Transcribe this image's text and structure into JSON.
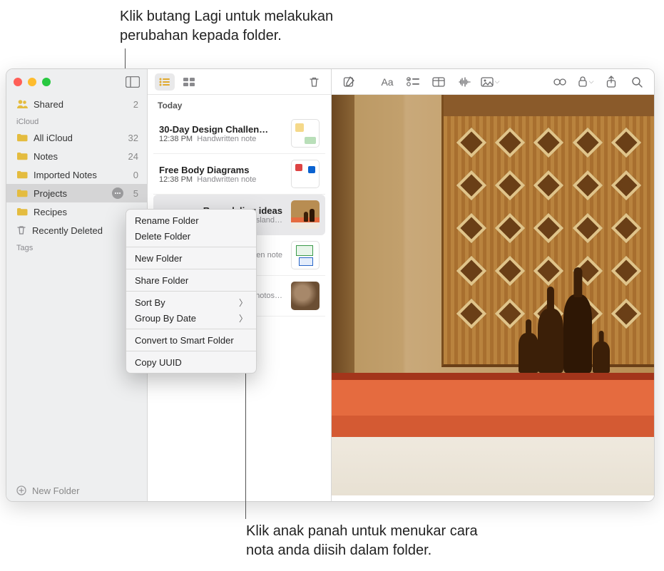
{
  "callouts": {
    "top": "Klik butang Lagi untuk melakukan\nperubahan kepada folder.",
    "bottom": "Klik anak panah untuk menukar cara\nnota anda diisih dalam folder."
  },
  "sidebar": {
    "shared": {
      "label": "Shared",
      "count": "2"
    },
    "sections": {
      "icloud_label": "iCloud",
      "tags_label": "Tags"
    },
    "folders": [
      {
        "label": "All iCloud",
        "count": "32"
      },
      {
        "label": "Notes",
        "count": "24"
      },
      {
        "label": "Imported Notes",
        "count": "0"
      },
      {
        "label": "Projects",
        "count": "5",
        "selected": true
      },
      {
        "label": "Recipes",
        "count": ""
      },
      {
        "label": "Recently Deleted",
        "count": ""
      }
    ],
    "new_folder_label": "New Folder"
  },
  "notelist": {
    "section_label": "Today",
    "items": [
      {
        "title": "30-Day Design Challen…",
        "time": "12:38 PM",
        "subtitle": "Handwritten note"
      },
      {
        "title": "Free Body Diagrams",
        "time": "12:38 PM",
        "subtitle": "Handwritten note"
      },
      {
        "title": "Remodeling ideas",
        "time": "",
        "subtitle": "Kitchen island…",
        "selected": true
      },
      {
        "title": "",
        "time": "",
        "subtitle": "Handwritten note"
      },
      {
        "title": "",
        "time": "",
        "subtitle": "2 photos…"
      }
    ]
  },
  "context_menu": {
    "rename": "Rename Folder",
    "delete": "Delete Folder",
    "new": "New Folder",
    "share": "Share Folder",
    "sort_by": "Sort By",
    "group_by_date": "Group By Date",
    "convert": "Convert to Smart Folder",
    "copy_uuid": "Copy UUID"
  },
  "icons": {
    "sidebar_toggle": "sidebar-toggle-icon",
    "compose": "compose-icon",
    "format": "Aa",
    "checklist": "checklist-icon",
    "table": "table-icon",
    "waveform": "waveform-icon",
    "media": "media-icon",
    "link": "link-icon",
    "lock": "lock-icon",
    "share": "share-icon",
    "search": "search-icon",
    "list_view": "list-view-icon",
    "grid_view": "grid-view-icon",
    "trash": "trash-icon"
  }
}
